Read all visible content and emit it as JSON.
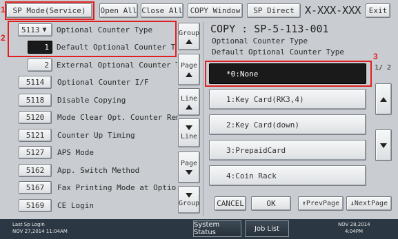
{
  "toolbar": {
    "sp_mode": "SP Mode(Service)",
    "open_all": "Open All",
    "close_all": "Close All",
    "copy_window": "COPY Window",
    "sp_direct": "SP Direct",
    "sp_number": "X-XXX-XXX",
    "exit": "Exit"
  },
  "tree": {
    "header": {
      "code": "5113",
      "label": "Optional Counter Type"
    },
    "selected": {
      "code": "1",
      "label": "Default Optional Counter Type"
    },
    "sub": {
      "code": "2",
      "label": "External Optional Counter Type"
    },
    "items": [
      {
        "code": "5114",
        "label": "Optional Counter I/F"
      },
      {
        "code": "5118",
        "label": "Disable Copying"
      },
      {
        "code": "5120",
        "label": "Mode Clear Opt. Counter Remova"
      },
      {
        "code": "5121",
        "label": "Counter Up Timing"
      },
      {
        "code": "5127",
        "label": "APS Mode"
      },
      {
        "code": "5162",
        "label": "App. Switch Method"
      },
      {
        "code": "5167",
        "label": "Fax Printing Mode at Optional"
      },
      {
        "code": "5169",
        "label": "CE Login"
      }
    ]
  },
  "scroll": {
    "group_up": "Group",
    "page_up": "Page",
    "line_up": "Line",
    "line_down": "Line",
    "page_down": "Page",
    "group_down": "Group"
  },
  "detail": {
    "title": "COPY : SP-5-113-001",
    "subtitle1": "Optional Counter Type",
    "subtitle2": "Default Optional Counter Type",
    "options": [
      "*0:None",
      "1:Key Card(RK3,4)",
      "2:Key Card(down)",
      "3:PrepaidCard",
      "4:Coin Rack"
    ],
    "page_indicator": "1/ 2",
    "cancel": "CANCEL",
    "ok": "OK",
    "prev_page": "PrevPage",
    "next_page": "NextPage"
  },
  "annotations": {
    "one": "1",
    "two": "2",
    "three": "3"
  },
  "status": {
    "login_line1": "Last Sp Login",
    "login_line2": "NOV  27,2014 11:04AM",
    "system_status": "System Status",
    "job_list": "Job List",
    "date": "NOV  28,2014",
    "time": "4:04PM"
  },
  "colors": {
    "highlight_red": "#e02020",
    "selected_bg": "#1a1a1a"
  }
}
